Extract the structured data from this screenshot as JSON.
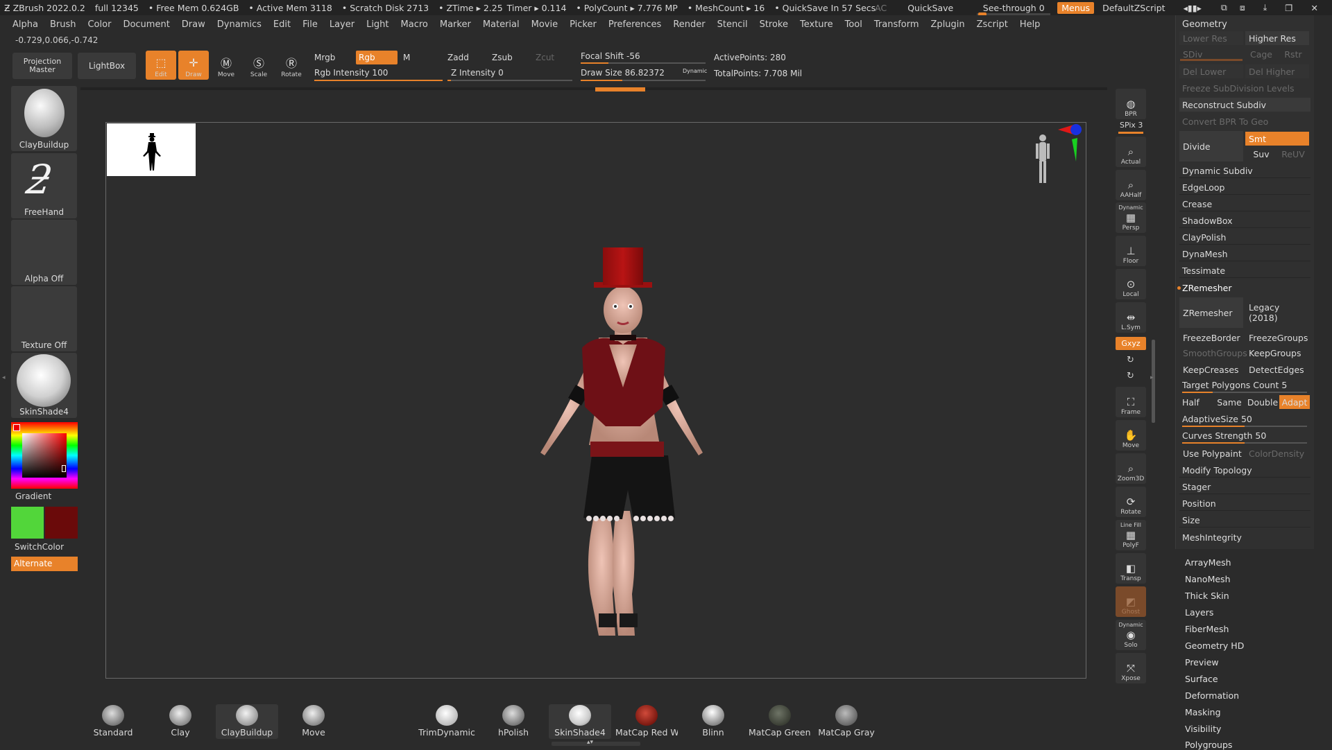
{
  "titlebar": {
    "app": "ZBrush 2022.0.2",
    "file": "full 12345",
    "free_mem": "• Free Mem 0.624GB",
    "active_mem": "• Active Mem 3118",
    "scratch": "• Scratch Disk 2713",
    "ztime": "• ZTime ▸ 2.25",
    "timer": "Timer ▸ 0.114",
    "polycount": "• PolyCount ▸ 7.776 MP",
    "meshcount": "• MeshCount ▸ 16",
    "quicksave_in": "• QuickSave In 57 Secs",
    "ac": "AC",
    "quicksave": "QuickSave",
    "seethrough": "See-through  0",
    "menus": "Menus",
    "zscript": "DefaultZScript"
  },
  "menu": [
    "Alpha",
    "Brush",
    "Color",
    "Document",
    "Draw",
    "Dynamics",
    "Edit",
    "File",
    "Layer",
    "Light",
    "Macro",
    "Marker",
    "Material",
    "Movie",
    "Picker",
    "Preferences",
    "Render",
    "Stencil",
    "Stroke",
    "Texture",
    "Tool",
    "Transform",
    "Zplugin",
    "Zscript",
    "Help"
  ],
  "coords": "-0.729,0.066,-0.742",
  "shelf": {
    "projection_master": "Projection Master",
    "lightbox": "LightBox",
    "edit": "Edit",
    "draw": "Draw",
    "move": "Move",
    "scale": "Scale",
    "rotate": "Rotate",
    "mrgb": "Mrgb",
    "rgb": "Rgb",
    "m": "M",
    "rgb_intensity": "Rgb Intensity 100",
    "zadd": "Zadd",
    "zsub": "Zsub",
    "zcut": "Zcut",
    "z_intensity": "Z Intensity 0",
    "focal_shift": "Focal Shift -56",
    "draw_size": "Draw Size 86.82372",
    "dynamic": "Dynamic",
    "active_points": "ActivePoints: 280",
    "total_points": "TotalPoints: 7.708 Mil"
  },
  "left_tray": {
    "brush": "ClayBuildup",
    "stroke": "FreeHand",
    "alpha": "Alpha Off",
    "texture": "Texture Off",
    "material": "SkinShade4",
    "gradient": "Gradient",
    "switchcolor": "SwitchColor",
    "alternate": "Alternate"
  },
  "right_tray": {
    "bpr": "BPR",
    "spix": "SPix 3",
    "actual": "Actual",
    "aahalf": "AAHalf",
    "dynamic": "Dynamic",
    "persp": "Persp",
    "floor": "Floor",
    "local": "Local",
    "lsym": "L.Sym",
    "xyz": "Gxyz",
    "frame": "Frame",
    "move": "Move",
    "zoom3d": "Zoom3D",
    "rotate": "Rotate",
    "linefill": "Line Fill",
    "polyf": "PolyF",
    "transp": "Transp",
    "ghost": "Ghost",
    "dynamic2": "Dynamic",
    "solo": "Solo",
    "xpose": "Xpose"
  },
  "geometry": {
    "title": "Geometry",
    "lower_res": "Lower Res",
    "higher_res": "Higher Res",
    "sdiv": "SDiv",
    "cage": "Cage",
    "rstr": "Rstr",
    "del_lower": "Del Lower",
    "del_higher": "Del Higher",
    "freeze_subdiv": "Freeze SubDivision Levels",
    "reconstruct": "Reconstruct Subdiv",
    "convert_bpr": "Convert BPR To Geo",
    "divide": "Divide",
    "smt": "Smt",
    "suv": "Suv",
    "reuv": "ReUV",
    "dynamic_subdiv": "Dynamic Subdiv",
    "edgeloop": "EdgeLoop",
    "crease": "Crease",
    "shadowbox": "ShadowBox",
    "claypolish": "ClayPolish",
    "dynamesh": "DynaMesh",
    "tessimate": "Tessimate",
    "zremesher_head": "ZRemesher",
    "zremesher": "ZRemesher",
    "legacy": "Legacy (2018)",
    "freezeborder": "FreezeBorder",
    "freezegroups": "FreezeGroups",
    "smoothgroups": "SmoothGroups",
    "keepgroups": "KeepGroups",
    "keepcreases": "KeepCreases",
    "detectedges": "DetectEdges",
    "target_polys": "Target Polygons Count 5",
    "half": "Half",
    "same": "Same",
    "double": "Double",
    "adapt": "Adapt",
    "adaptive_size": "AdaptiveSize 50",
    "curves_strength": "Curves Strength 50",
    "use_polypaint": "Use Polypaint",
    "color_density": "ColorDensity",
    "modify_topology": "Modify Topology",
    "stager": "Stager",
    "position": "Position",
    "size": "Size",
    "meshintegrity": "MeshIntegrity"
  },
  "tool_subpalettes": [
    "ArrayMesh",
    "NanoMesh",
    "Thick Skin",
    "Layers",
    "FiberMesh",
    "Geometry HD",
    "Preview",
    "Surface",
    "Deformation",
    "Masking",
    "Visibility",
    "Polygroups"
  ],
  "bottom_shelf": {
    "brushes": [
      "Standard",
      "Clay",
      "ClayBuildup",
      "Move"
    ],
    "materials": [
      "TrimDynamic",
      "hPolish",
      "SkinShade4",
      "MatCap Red Wax",
      "Blinn",
      "MatCap GreenClay",
      "MatCap Gray"
    ]
  },
  "colors": {
    "accent": "#e8822a",
    "main_color": "#52d63a",
    "secondary_color": "#6a0a0a"
  }
}
